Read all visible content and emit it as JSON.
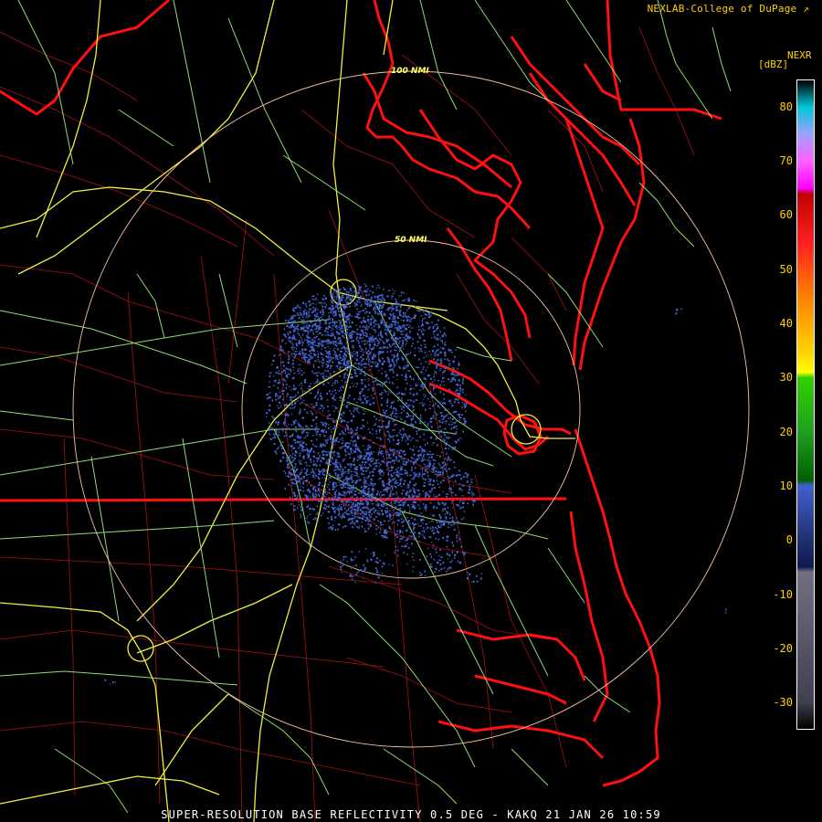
{
  "credit": "NEXLAB-College of DuPage",
  "credit_icon": "external-link-icon",
  "caption": "SUPER-RESOLUTION BASE REFLECTIVITY 0.5 DEG - KAKQ 21 JAN 26 10:59",
  "colorbar": {
    "title": "NEXR",
    "units": "[dBZ]",
    "ticks": [
      80,
      70,
      60,
      50,
      40,
      30,
      20,
      10,
      0,
      -10,
      -20,
      -30
    ],
    "tick_labels": [
      "80",
      "70",
      "60",
      "50",
      "40",
      "30",
      "20",
      "10",
      "0",
      "-10",
      "-20",
      "-30"
    ],
    "range": [
      -35,
      85
    ],
    "stops": [
      {
        "dbz": 85,
        "color": "#000000"
      },
      {
        "dbz": 80,
        "color": "#00c8d8"
      },
      {
        "dbz": 75,
        "color": "#a0a0ff"
      },
      {
        "dbz": 70,
        "color": "#ff60ff"
      },
      {
        "dbz": 65,
        "color": "#ff00ff"
      },
      {
        "dbz": 64,
        "color": "#c00000"
      },
      {
        "dbz": 55,
        "color": "#ff2020"
      },
      {
        "dbz": 45,
        "color": "#ff8000"
      },
      {
        "dbz": 35,
        "color": "#ffd000"
      },
      {
        "dbz": 31,
        "color": "#ffff00"
      },
      {
        "dbz": 30,
        "color": "#30d000"
      },
      {
        "dbz": 20,
        "color": "#20a020"
      },
      {
        "dbz": 11,
        "color": "#006000"
      },
      {
        "dbz": 10,
        "color": "#4060d0"
      },
      {
        "dbz": 0,
        "color": "#203070"
      },
      {
        "dbz": -5,
        "color": "#101850"
      },
      {
        "dbz": -6,
        "color": "#707080"
      },
      {
        "dbz": -30,
        "color": "#404050"
      },
      {
        "dbz": -35,
        "color": "#000000"
      }
    ]
  },
  "range_rings": [
    {
      "label": "50 NMI",
      "nmi": 50
    },
    {
      "label": "100 NMI",
      "nmi": 100
    }
  ],
  "colors": {
    "background": "#000000",
    "coast_state": "#ff1010",
    "county": "#c01818",
    "highway_primary": "#f0f040",
    "highway_secondary": "#98e878",
    "range_ring": "#f4c2a0",
    "echo": "#4060c8"
  }
}
